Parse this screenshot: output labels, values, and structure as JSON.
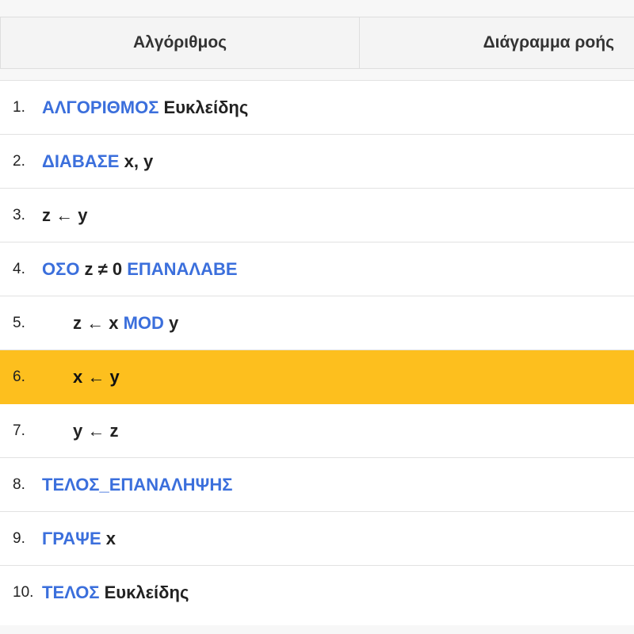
{
  "table": {
    "columns": {
      "algorithm": "Αλγόριθμος",
      "flowchart": "Διάγραμμα ροής"
    },
    "rows": [
      {
        "num": "1.",
        "indent": 0,
        "tokens": [
          {
            "t": "ΑΛΓΟΡΙΘΜΟΣ",
            "k": true
          },
          {
            "t": " Ευκλείδης",
            "k": false
          }
        ]
      },
      {
        "num": "2.",
        "indent": 0,
        "tokens": [
          {
            "t": "ΔΙΑΒΑΣΕ",
            "k": true
          },
          {
            "t": " x, y",
            "k": false
          }
        ]
      },
      {
        "num": "3.",
        "indent": 0,
        "tokens": [
          {
            "t": "z ← y",
            "k": false
          }
        ]
      },
      {
        "num": "4.",
        "indent": 0,
        "tokens": [
          {
            "t": "ΟΣΟ",
            "k": true
          },
          {
            "t": " z ≠ 0 ",
            "k": false
          },
          {
            "t": "ΕΠΑΝΑΛΑΒΕ",
            "k": true
          }
        ]
      },
      {
        "num": "5.",
        "indent": 1,
        "tokens": [
          {
            "t": "z ← x ",
            "k": false
          },
          {
            "t": "MOD",
            "k": true
          },
          {
            "t": " y",
            "k": false
          }
        ]
      },
      {
        "num": "6.",
        "indent": 1,
        "active": true,
        "tokens": [
          {
            "t": "x ← y",
            "k": false
          }
        ]
      },
      {
        "num": "7.",
        "indent": 1,
        "tokens": [
          {
            "t": "y ← z",
            "k": false
          }
        ]
      },
      {
        "num": "8.",
        "indent": 0,
        "tokens": [
          {
            "t": "ΤΕΛΟΣ_ΕΠΑΝΑΛΗΨΗΣ",
            "k": true
          }
        ]
      },
      {
        "num": "9.",
        "indent": 0,
        "tokens": [
          {
            "t": "ΓΡΑΨΕ",
            "k": true
          },
          {
            "t": " x",
            "k": false
          }
        ]
      },
      {
        "num": "10.",
        "indent": 0,
        "tokens": [
          {
            "t": "ΤΕΛΟΣ",
            "k": true
          },
          {
            "t": " Ευκλείδης",
            "k": false
          }
        ]
      }
    ]
  },
  "colors": {
    "keyword": "#3b6fdc",
    "highlight": "#fdbf1e",
    "text": "#222222"
  }
}
